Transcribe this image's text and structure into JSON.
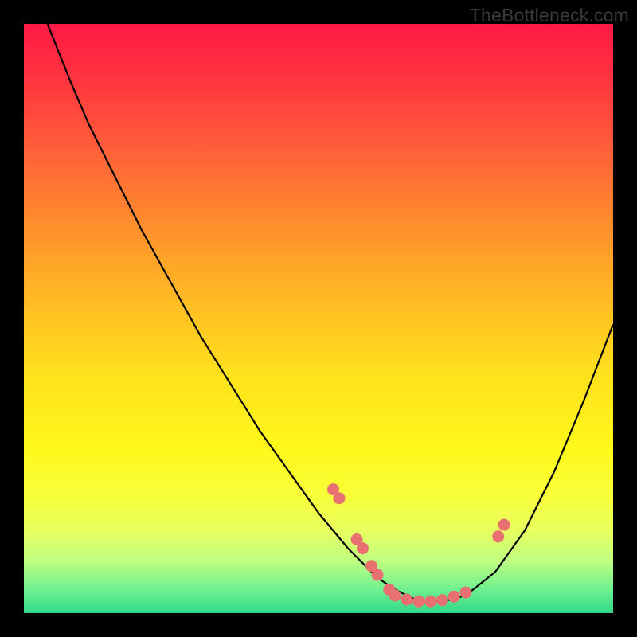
{
  "watermark": "TheBottleneck.com",
  "colors": {
    "dot": "#e97070",
    "curve": "#000000",
    "frame_bg_top": "#ff1a44",
    "frame_bg_bottom": "#30d888",
    "page_bg": "#000000"
  },
  "chart_data": {
    "type": "line",
    "title": "",
    "xlabel": "",
    "ylabel": "",
    "xlim": [
      0,
      100
    ],
    "ylim": [
      0,
      100
    ],
    "grid": false,
    "legend": false,
    "series": [
      {
        "name": "curve",
        "x": [
          4,
          6,
          8,
          11,
          15,
          20,
          25,
          30,
          35,
          40,
          45,
          50,
          55,
          60,
          63,
          66,
          68,
          70,
          72,
          75,
          80,
          85,
          90,
          95,
          100
        ],
        "y": [
          100,
          95,
          90,
          83,
          75,
          65,
          56,
          47,
          39,
          31,
          24,
          17,
          11,
          6,
          4,
          2.5,
          2,
          2,
          2.2,
          3,
          7,
          14,
          24,
          36,
          49
        ]
      }
    ],
    "points": [
      {
        "x": 52.5,
        "y": 21
      },
      {
        "x": 53.5,
        "y": 19.5
      },
      {
        "x": 56.5,
        "y": 12.5
      },
      {
        "x": 57.5,
        "y": 11
      },
      {
        "x": 59,
        "y": 8
      },
      {
        "x": 60,
        "y": 6.5
      },
      {
        "x": 62,
        "y": 4
      },
      {
        "x": 63,
        "y": 3
      },
      {
        "x": 65,
        "y": 2.3
      },
      {
        "x": 67,
        "y": 2
      },
      {
        "x": 69,
        "y": 2
      },
      {
        "x": 71,
        "y": 2.2
      },
      {
        "x": 73,
        "y": 2.8
      },
      {
        "x": 75,
        "y": 3.5
      },
      {
        "x": 80.5,
        "y": 13
      },
      {
        "x": 81.5,
        "y": 15
      }
    ]
  }
}
